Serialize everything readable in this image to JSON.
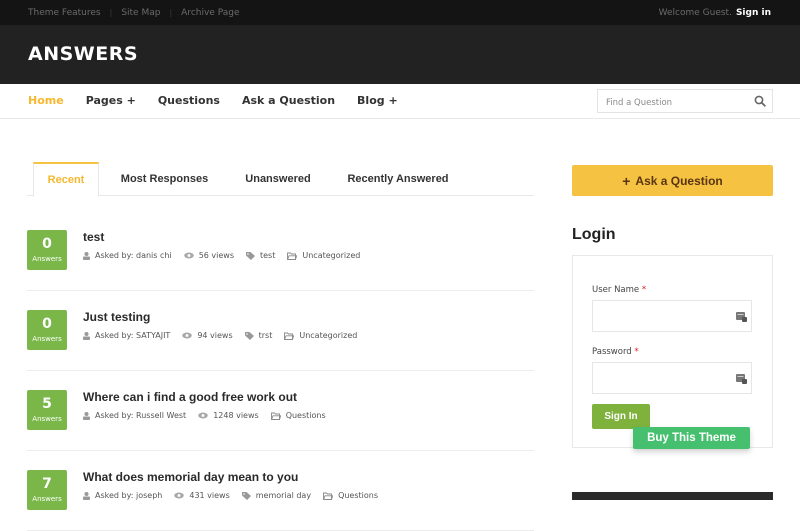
{
  "topbar": {
    "links": [
      "Theme Features",
      "Site Map",
      "Archive Page"
    ],
    "welcome": "Welcome Guest.",
    "signin": "Sign in"
  },
  "header": {
    "logo": "ANSWERS"
  },
  "nav": {
    "items": [
      {
        "label": "Home",
        "active": true
      },
      {
        "label": "Pages +"
      },
      {
        "label": "Questions"
      },
      {
        "label": "Ask a Question"
      },
      {
        "label": "Blog +"
      }
    ],
    "search_placeholder": "Find a Question",
    "search_icon": "search-icon"
  },
  "tabs": [
    {
      "label": "Recent",
      "active": true
    },
    {
      "label": "Most Responses"
    },
    {
      "label": "Unanswered"
    },
    {
      "label": "Recently Answered"
    }
  ],
  "questions": [
    {
      "answers": "0",
      "answers_label": "Answers",
      "title": "test",
      "asked_by": "Asked by: danis chi",
      "views": "56 views",
      "tag": "test",
      "category": "Uncategorized"
    },
    {
      "answers": "0",
      "answers_label": "Answers",
      "title": "Just testing",
      "asked_by": "Asked by: SATYAJIT",
      "views": "94 views",
      "tag": "trst",
      "category": "Uncategorized"
    },
    {
      "answers": "5",
      "answers_label": "Answers",
      "title": "Where can i find a good free work out",
      "asked_by": "Asked by: Russell West",
      "views": "1248 views",
      "tag": null,
      "category": "Questions"
    },
    {
      "answers": "7",
      "answers_label": "Answers",
      "title": "What does memorial day mean to you",
      "asked_by": "Asked by: joseph",
      "views": "431 views",
      "tag": "memorial day",
      "category": "Questions"
    }
  ],
  "sidebar": {
    "ask_button": "Ask a Question",
    "ask_icon": "+",
    "login_title": "Login",
    "username_label": "User Name",
    "password_label": "Password",
    "required_mark": "*",
    "signin_button": "Sign In",
    "buy_button": "Buy This Theme"
  },
  "colors": {
    "accent": "#f5c242",
    "answers_badge": "#7ab648",
    "signin_green": "#7fb13d",
    "buy_green": "#46c06e",
    "header_dark": "#222222",
    "topbar_dark": "#141414"
  }
}
